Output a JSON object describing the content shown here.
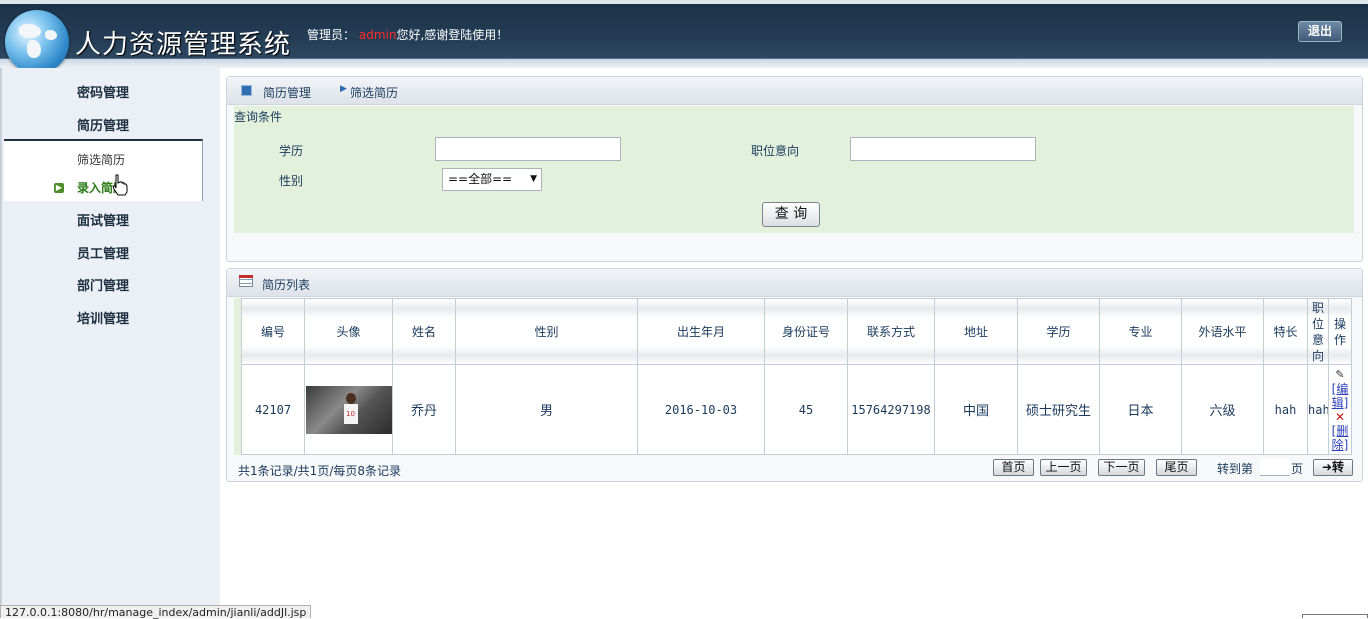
{
  "header": {
    "title": "人力资源管理系统",
    "admin_prefix": "管理员：",
    "username": "admin",
    "greeting_suffix": "您好,感谢登陆使用！",
    "logout_label": "退出"
  },
  "sidebar": {
    "items": [
      {
        "label": "密码管理"
      },
      {
        "label": "简历管理"
      },
      {
        "label": "面试管理"
      },
      {
        "label": "员工管理"
      },
      {
        "label": "部门管理"
      },
      {
        "label": "培训管理"
      }
    ],
    "submenu": [
      {
        "label": "筛选简历",
        "active": false
      },
      {
        "label": "录入简历",
        "active": true
      }
    ]
  },
  "breadcrumb": {
    "section": "简历管理",
    "page": "筛选简历"
  },
  "query": {
    "title": "查询条件",
    "education_label": "学历",
    "education_value": "",
    "position_label": "职位意向",
    "position_value": "",
    "gender_label": "性别",
    "gender_selected": "==全部==",
    "submit_label": "查 询"
  },
  "list": {
    "title": "简历列表",
    "columns": [
      "编号",
      "头像",
      "姓名",
      "性别",
      "出生年月",
      "身份证号",
      "联系方式",
      "地址",
      "学历",
      "专业",
      "外语水平",
      "特长",
      "职位意向",
      "操作"
    ],
    "rows": [
      {
        "id": "42107",
        "name": "乔丹",
        "gender": "男",
        "birth": "2016-10-03",
        "id_card": "45",
        "phone": "15764297198",
        "address": "中国",
        "education": "硕士研究生",
        "major": "日本",
        "language": "六级",
        "specialty": "hah",
        "intention": "hah",
        "edit_label": "[编辑]",
        "delete_label": "[删除]"
      }
    ]
  },
  "pager": {
    "info": "共1条记录/共1页/每页8条记录",
    "first": "首页",
    "prev": "上一页",
    "next": "下一页",
    "last": "尾页",
    "goto_prefix": "转到第",
    "goto_value": "",
    "goto_suffix": "页",
    "go": "➜转"
  },
  "statusbar": {
    "url": "127.0.0.1:8080/hr/manage_index/admin/jianli/addJl.jsp"
  },
  "icons": {
    "edit": "pencil-icon",
    "delete": "x-icon",
    "submenu_bullet": "arrow-right-icon"
  }
}
